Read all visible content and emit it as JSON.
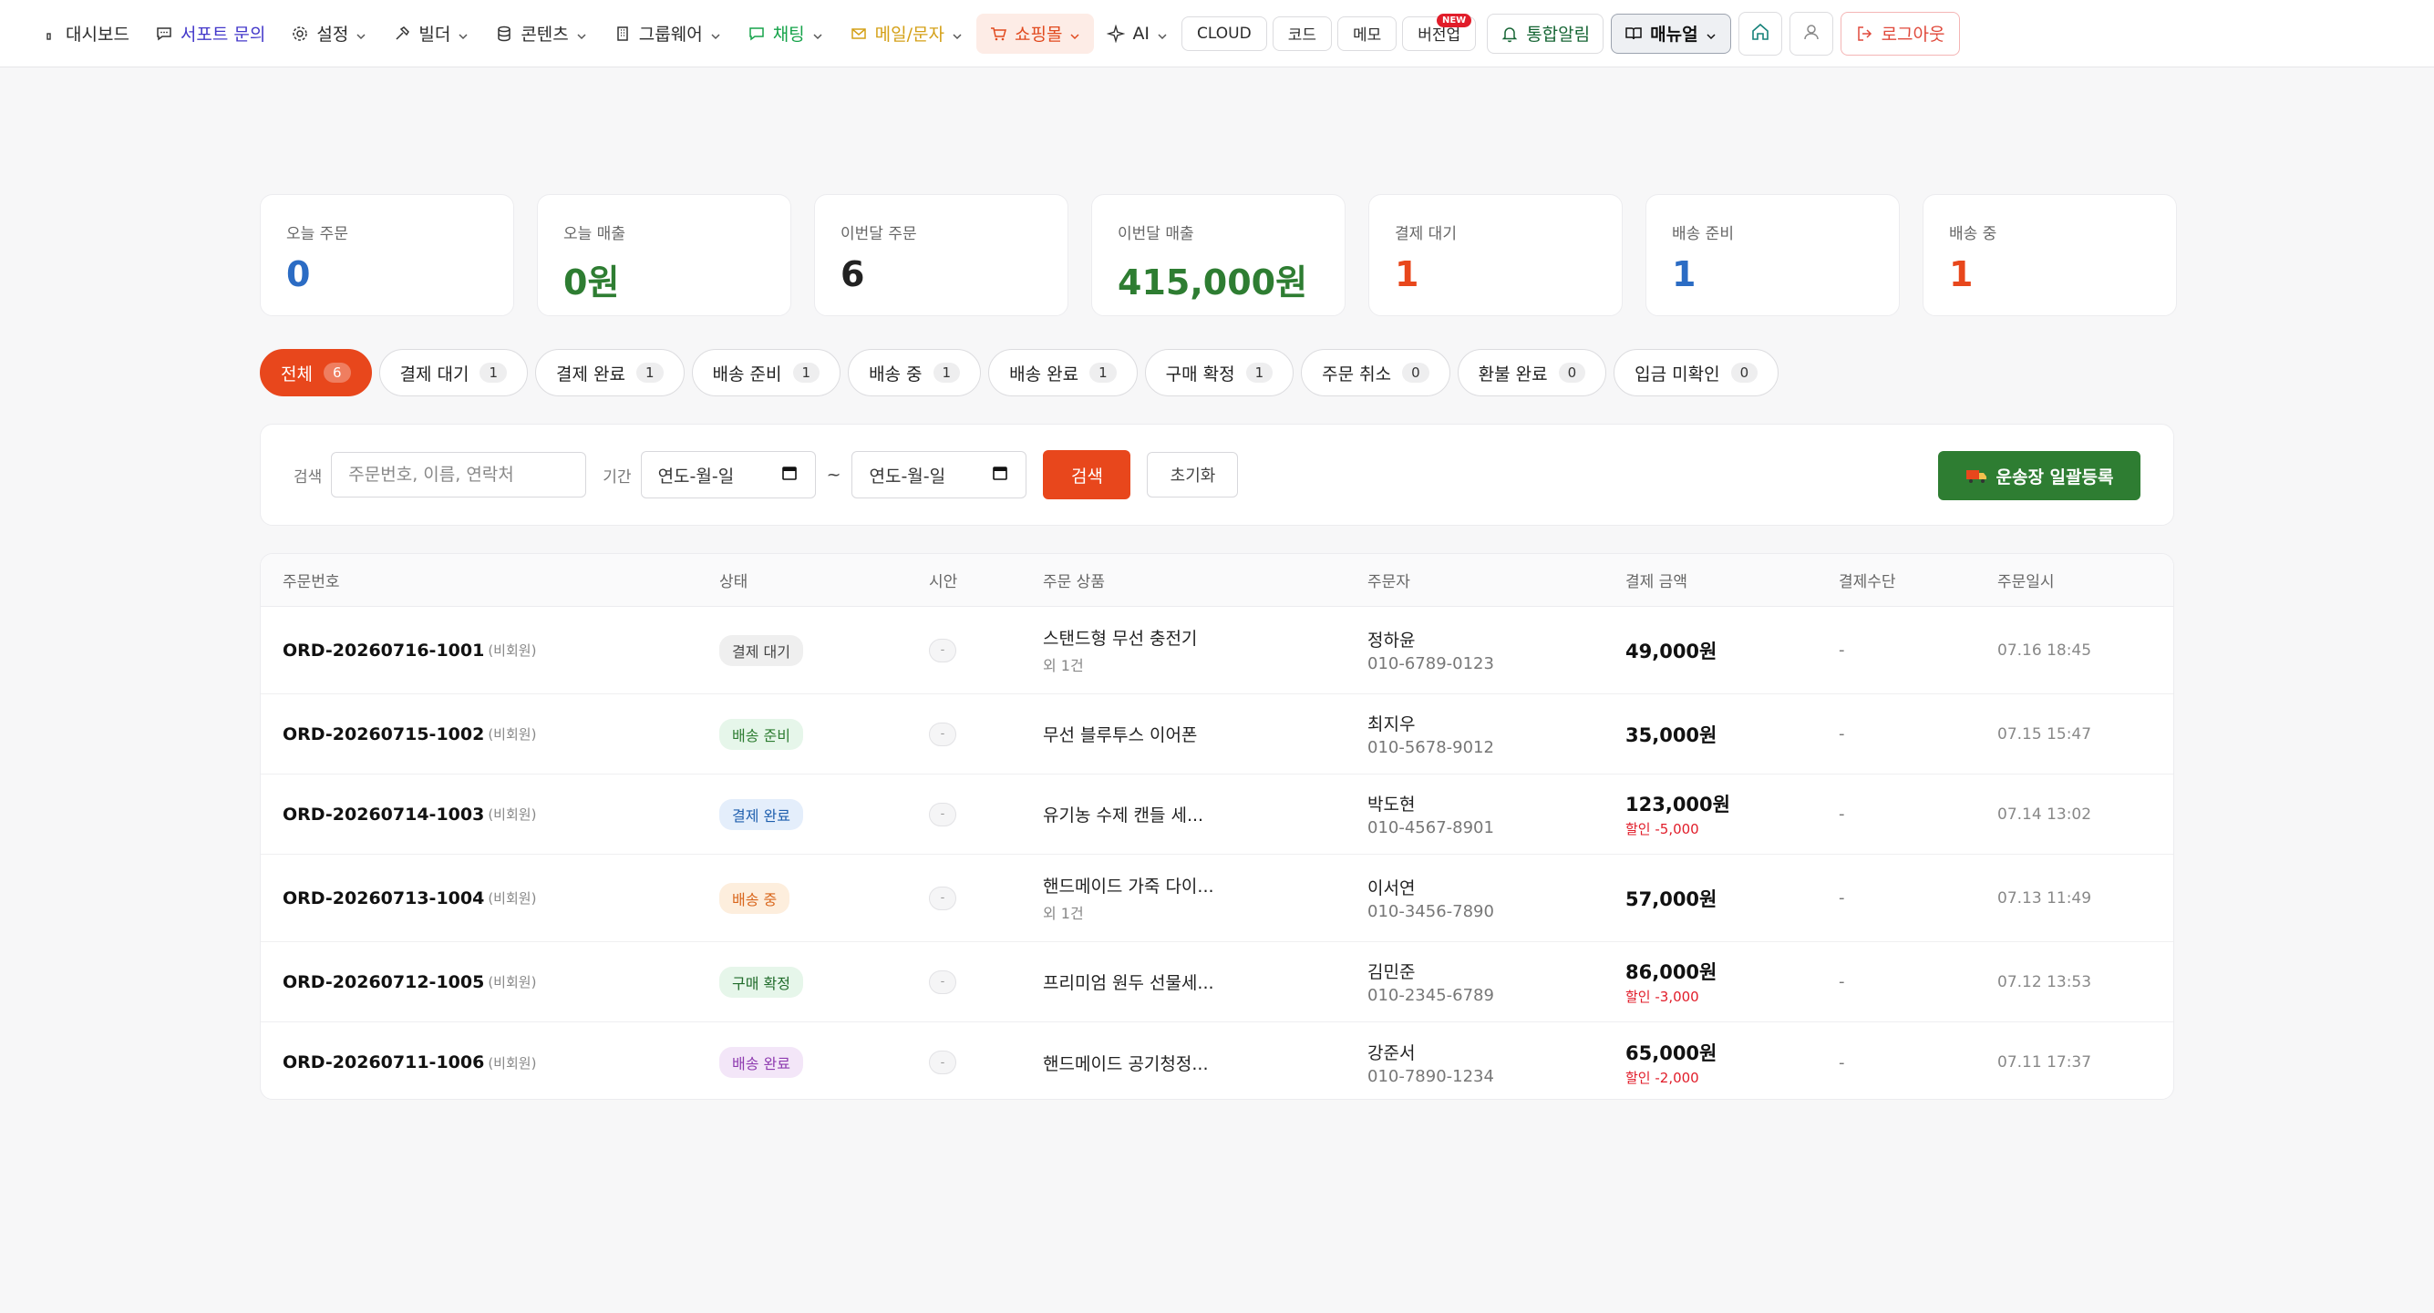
{
  "nav": {
    "dashboard": "대시보드",
    "support": "서포트 문의",
    "settings": "설정",
    "builder": "빌더",
    "contents": "콘텐츠",
    "groupware": "그룹웨어",
    "chat": "채팅",
    "mail": "메일/문자",
    "shop": "쇼핑몰",
    "ai": "AI",
    "cloud": "CLOUD",
    "code": "코드",
    "memo": "메모",
    "version": "버전업",
    "version_badge": "NEW",
    "alarm": "통합알림",
    "manual": "매뉴얼",
    "logout": "로그아웃"
  },
  "stats": [
    {
      "label": "오늘 주문",
      "value": "0",
      "color": "#2b6cc4"
    },
    {
      "label": "오늘 매출",
      "value": "0원",
      "color": "#2e7d32"
    },
    {
      "label": "이번달 주문",
      "value": "6",
      "color": "#222222"
    },
    {
      "label": "이번달 매출",
      "value": "415,000원",
      "color": "#2e7d32"
    },
    {
      "label": "결제 대기",
      "value": "1",
      "color": "#e8471c"
    },
    {
      "label": "배송 준비",
      "value": "1",
      "color": "#2b6cc4"
    },
    {
      "label": "배송 중",
      "value": "1",
      "color": "#e8471c"
    }
  ],
  "tabs": [
    {
      "label": "전체",
      "count": "6"
    },
    {
      "label": "결제 대기",
      "count": "1"
    },
    {
      "label": "결제 완료",
      "count": "1"
    },
    {
      "label": "배송 준비",
      "count": "1"
    },
    {
      "label": "배송 중",
      "count": "1"
    },
    {
      "label": "배송 완료",
      "count": "1"
    },
    {
      "label": "구매 확정",
      "count": "1"
    },
    {
      "label": "주문 취소",
      "count": "0"
    },
    {
      "label": "환불 완료",
      "count": "0"
    },
    {
      "label": "입금 미확인",
      "count": "0"
    }
  ],
  "search": {
    "label": "검색",
    "placeholder": "주문번호, 이름, 연락처",
    "period_label": "기간",
    "date_from": "연도-월-일",
    "date_to": "연도-월-일",
    "tilde": "~",
    "search_btn": "검색",
    "reset_btn": "초기화",
    "bulk_btn": "운송장 일괄등록"
  },
  "table": {
    "headers": {
      "id": "주문번호",
      "status": "상태",
      "time": "시안",
      "product": "주문 상품",
      "customer": "주문자",
      "amount": "결제 금액",
      "payment": "결제수단",
      "date": "주문일시"
    },
    "rows": [
      {
        "id": "ORD-20260716-1001",
        "guest": "(비회원)",
        "status": "결제 대기",
        "status_bg": "#efefef",
        "status_fg": "#444444",
        "time": "-",
        "product": "스탠드형 무선 충전기",
        "product_sub": "외 1건",
        "customer": "정하윤",
        "phone": "010-6789-0123",
        "amount": "49,000원",
        "discount": "",
        "payment": "-",
        "date": "07.16 18:45"
      },
      {
        "id": "ORD-20260715-1002",
        "guest": "(비회원)",
        "status": "배송 준비",
        "status_bg": "#e6f6ea",
        "status_fg": "#2e7d32",
        "time": "-",
        "product": "무선 블루투스 이어폰",
        "product_sub": "",
        "customer": "최지우",
        "phone": "010-5678-9012",
        "amount": "35,000원",
        "discount": "",
        "payment": "-",
        "date": "07.15 15:47"
      },
      {
        "id": "ORD-20260714-1003",
        "guest": "(비회원)",
        "status": "결제 완료",
        "status_bg": "#e4eefb",
        "status_fg": "#1f5fae",
        "time": "-",
        "product": "유기농 수제 캔들 세...",
        "product_sub": "",
        "customer": "박도현",
        "phone": "010-4567-8901",
        "amount": "123,000원",
        "discount": "할인 -5,000",
        "payment": "-",
        "date": "07.14 13:02"
      },
      {
        "id": "ORD-20260713-1004",
        "guest": "(비회원)",
        "status": "배송 중",
        "status_bg": "#fdeedd",
        "status_fg": "#d9661c",
        "time": "-",
        "product": "핸드메이드 가죽 다이...",
        "product_sub": "외 1건",
        "customer": "이서연",
        "phone": "010-3456-7890",
        "amount": "57,000원",
        "discount": "",
        "payment": "-",
        "date": "07.13 11:49"
      },
      {
        "id": "ORD-20260712-1005",
        "guest": "(비회원)",
        "status": "구매 확정",
        "status_bg": "#e6f6ea",
        "status_fg": "#1f6b2a",
        "time": "-",
        "product": "프리미엄 원두 선물세...",
        "product_sub": "",
        "customer": "김민준",
        "phone": "010-2345-6789",
        "amount": "86,000원",
        "discount": "할인 -3,000",
        "payment": "-",
        "date": "07.12 13:53"
      },
      {
        "id": "ORD-20260711-1006",
        "guest": "(비회원)",
        "status": "배송 완료",
        "status_bg": "#f3e6f8",
        "status_fg": "#8e3bb0",
        "time": "-",
        "product": "핸드메이드 공기청정...",
        "product_sub": "",
        "customer": "강준서",
        "phone": "010-7890-1234",
        "amount": "65,000원",
        "discount": "할인 -2,000",
        "payment": "-",
        "date": "07.11 17:37"
      }
    ]
  }
}
